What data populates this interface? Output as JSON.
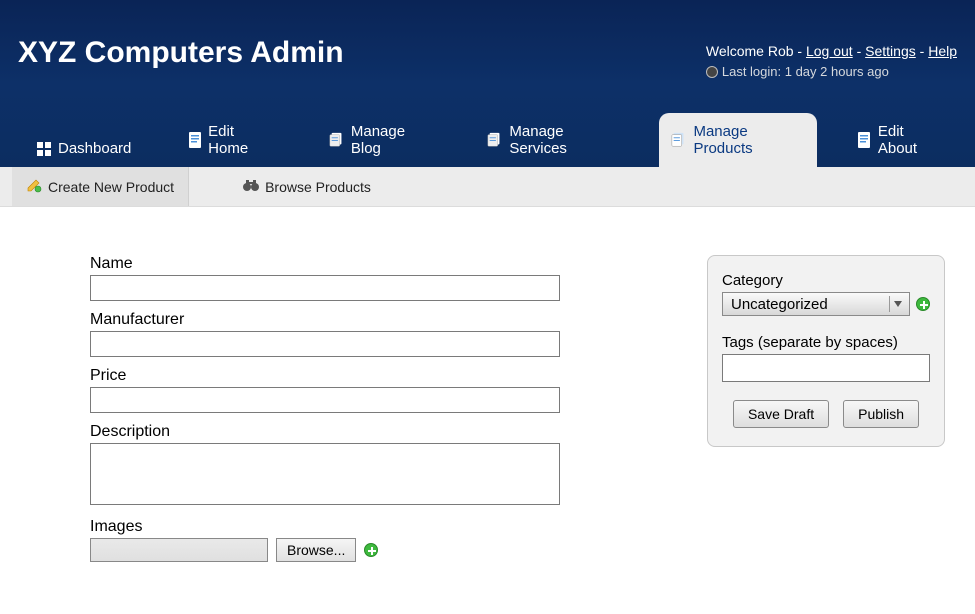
{
  "header": {
    "title": "XYZ Computers Admin",
    "welcome_prefix": "Welcome ",
    "username": "Rob",
    "sep": " - ",
    "logout": "Log out",
    "settings": "Settings",
    "help": "Help",
    "last_login_label": "Last login: ",
    "last_login_value": "1 day 2 hours ago"
  },
  "nav": {
    "dashboard": "Dashboard",
    "edit_home": "Edit Home",
    "manage_blog": "Manage Blog",
    "manage_services": "Manage Services",
    "manage_products": "Manage Products",
    "edit_about": "Edit About"
  },
  "subnav": {
    "create_product": "Create New Product",
    "browse_products": "Browse Products"
  },
  "form": {
    "name_label": "Name",
    "name_value": "",
    "manufacturer_label": "Manufacturer",
    "manufacturer_value": "",
    "price_label": "Price",
    "price_value": "",
    "description_label": "Description",
    "description_value": "",
    "images_label": "Images",
    "browse_label": "Browse..."
  },
  "sidebar": {
    "category_label": "Category",
    "category_value": "Uncategorized",
    "tags_label": "Tags (separate by spaces)",
    "tags_value": "",
    "save_draft": "Save Draft",
    "publish": "Publish"
  },
  "icons": {
    "dashboard": "dashboard-icon",
    "page": "page-icon",
    "stack": "stack-icon",
    "pencil": "pencil-icon",
    "binoculars": "binoculars-icon",
    "plus": "plus-icon",
    "clock": "clock-icon",
    "chevron_down": "chevron-down-icon"
  }
}
